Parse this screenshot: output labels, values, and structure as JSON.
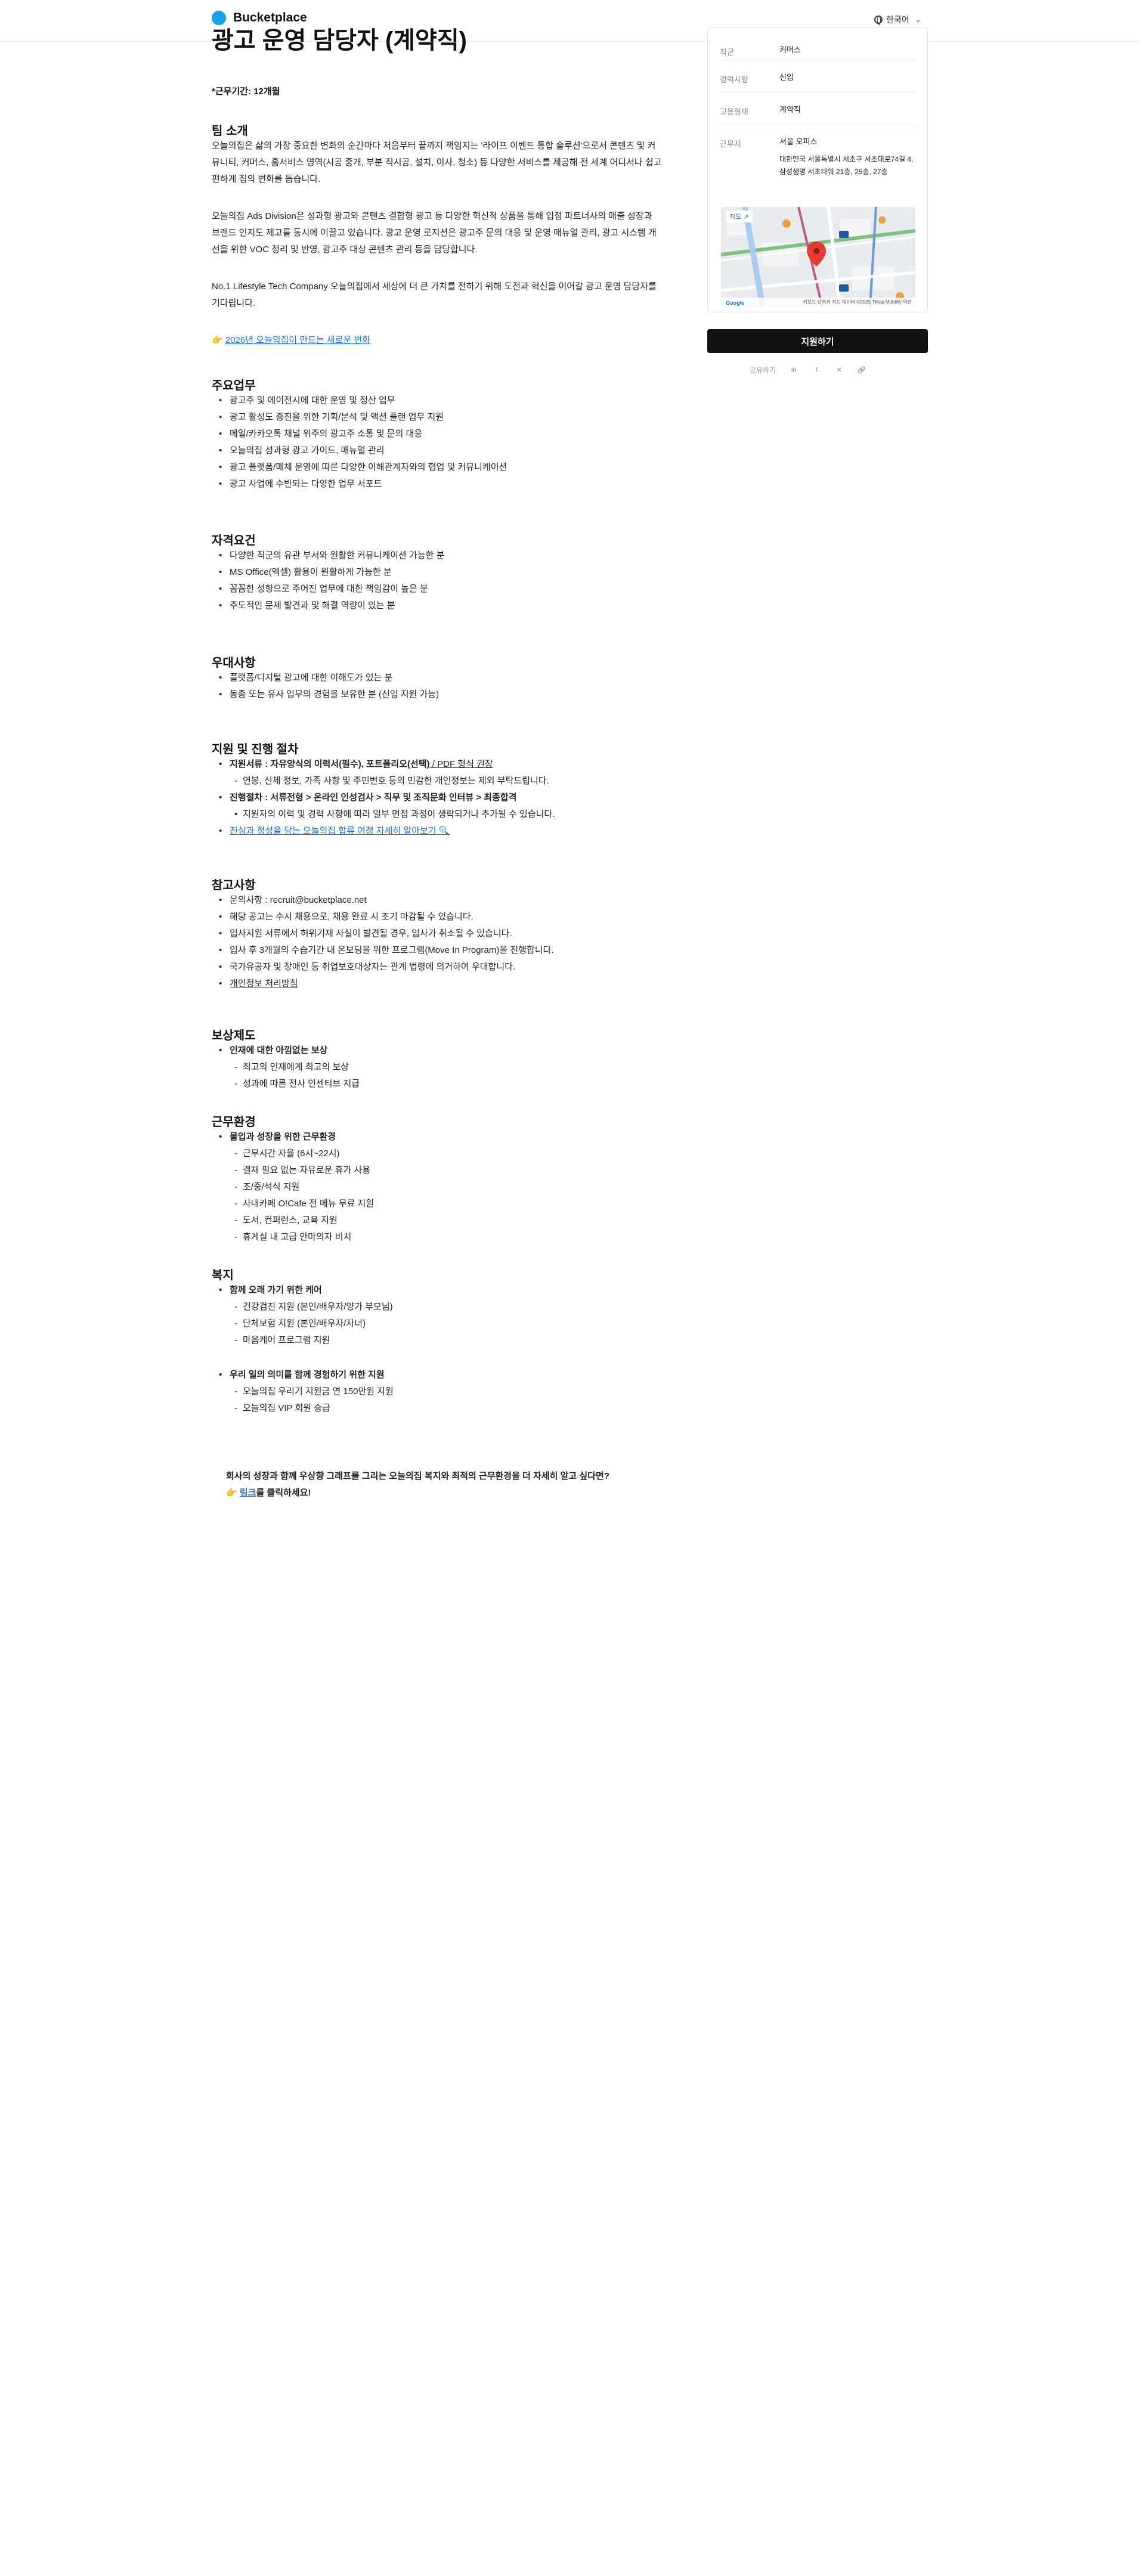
{
  "header": {
    "brand": "Bucketplace",
    "language": "한국어"
  },
  "job": {
    "title": "광고 운영 담당자 (계약직)",
    "duration": "*근무기간: 12개월"
  },
  "team": {
    "heading": "팀 소개",
    "p1": "오늘의집은 삶의 가장 중요한 변화의 순간마다 처음부터 끝까지 책임지는 '라이프 이벤트 통합 솔루션'으로서 콘텐츠 및 커뮤니티, 커머스, 홈서비스 영역(시공 중개, 부분 직시공, 설치, 이사, 청소) 등 다양한 서비스를 제공해 전 세계 어디서나 쉽고 편하게 집의 변화를 돕습니다.",
    "p2": "오늘의집 Ads Division은 성과형 광고와 콘텐츠 결합형 광고 등 다양한 혁신적 상품을 통해 입점 파트너사의 매출 성장과 브랜드 인지도 제고를 동시에 이끌고 있습니다. 광고 운영 로지션은 광고주 문의 대응 및 운영 매뉴얼 관리, 광고 시스템 개선을 위한 VOC 정리 및 반영, 광고주 대상 콘텐츠 관리 등을 담당합니다.",
    "p3": "No.1 Lifestyle Tech Company 오늘의집에서 세상에 더 큰 가치를 전하기 위해 도전과 혁신을 이어갈 광고 운영 담당자를 기다립니다.",
    "link_prefix": "👉",
    "link_text": "2026년 오늘의집이 만드는 새로운 변화"
  },
  "duties": {
    "heading": "주요업무",
    "items": [
      "광고주 및 에이전시에 대한 운영 및 정산 업무",
      "광고 활성도 증진을 위한 기획/분석 및 액션 플랜 업무 지원",
      "메일/카카오톡 채널 위주의 광고주 소통 및 문의 대응",
      "오늘의집 성과형 광고 가이드, 매뉴얼 관리",
      "광고 플랫폼/매체 운영에 따른 다양한 이해관계자와의 협업 및 커뮤니케이션",
      "광고 사업에 수반되는 다양한 업무 서포트"
    ]
  },
  "requirements": {
    "heading": "자격요건",
    "items": [
      "다양한 직군의 유관 부서와 원활한 커뮤니케이션 가능한 분",
      "MS Office(엑셀) 활용이 원활하게 가능한 분",
      "꼼꼼한 성향으로 주어진 업무에 대한 책임감이 높은 분",
      "주도적인 문제 발견과 및 해결 역량이 있는 분"
    ]
  },
  "preferred": {
    "heading": "우대사항",
    "items": [
      "플랫폼/디지털 광고에 대한 이해도가 있는 분",
      "동종 또는 유사 업무의 경험을 보유한 분 (신입 지원 가능)"
    ]
  },
  "process": {
    "heading": "지원 및 진행 절차",
    "doc_label": "지원서류 : 자유양식의 이력서(필수), 포트폴리오(선택)",
    "doc_suffix": " / PDF 형식 권장",
    "doc_note": "연봉, 신체 정보, 가족 사항 및 주민번호 등의 민감한 개인정보는 제외 부탁드립니다.",
    "steps_label": "진행절차 : 서류전형 > 온라인 인성검사 > 직무 및 조직문화 인터뷰 > 최종합격",
    "steps_note": "지원자의 이력 및 경력 사항에 따라 일부 면접 과정이 생략되거나 추가될 수 있습니다.",
    "faq_link": "진심과 정성을 담는 오늘의집 합류 여정 자세히 알아보기 🔍"
  },
  "notes": {
    "heading": "참고사항",
    "items": [
      "문의사항 : recruit@bucketplace.net",
      "해당 공고는 수시 채용으로, 채용 완료 시 조기 마감될 수 있습니다.",
      "입사지원 서류에서 허위기재 사실이 발견될 경우, 입사가 취소될 수 있습니다.",
      "입사 후 3개월의 수습기간 내 온보딩을 위한 프로그램(Move In Program)을 진행합니다.",
      "국가유공자 및 장애인 등 취업보호대상자는 관계 법령에 의거하여 우대합니다."
    ],
    "privacy": "개인정보 처리방침"
  },
  "compensation": {
    "heading": "보상제도",
    "title": "인재에 대한 아낌없는 보상",
    "items": [
      "최고의 인재에게 최고의 보상",
      "성과에 따른 전사 인센티브 지급"
    ]
  },
  "environment": {
    "heading": "근무환경",
    "title": "몰입과 성장을 위한 근무환경",
    "items": [
      "근무시간 자율 (6시~22시)",
      "결재 필요 없는 자유로운 휴가 사용",
      "조/중/석식 지원",
      "사내카페 O!Cafe 전 메뉴 무료 지원",
      "도서, 컨퍼런스, 교육 지원",
      "휴게실 내 고급 안마의자 비치"
    ]
  },
  "welfare": {
    "heading": "복지",
    "title1": "함께 오래 가기 위한 케어",
    "items1": [
      "건강검진 지원 (본인/배우자/양가 부모님)",
      "단체보험 지원 (본인/배우자/자녀)",
      "마음케어 프로그램 지원"
    ],
    "title2": "우리 일의 의미를 함께 경험하기 위한 지원",
    "items2": [
      "오늘의집 우리기 지원금 연 150만원 지원",
      "오늘의집 VIP 회원 승급"
    ]
  },
  "closing": {
    "line1": "회사의 성장과 함께 우상향 그래프를 그리는 오늘의집 복지와 최적의 근무환경을 더 자세히 알고 싶다면?",
    "prefix": "👉 ",
    "link": "링크",
    "suffix": "를 클릭하세요!"
  },
  "panel": {
    "rows": [
      {
        "label": "직군",
        "value": "커머스"
      },
      {
        "label": "경력사항",
        "value": "신입"
      },
      {
        "label": "고용형태",
        "value": "계약직"
      }
    ],
    "location_label": "근무지",
    "location_name": "서울 오피스",
    "location_address": "대한민국 서울특별시 서초구 서초대로74길 4, 삼성생명 서초타워 21층, 25층, 27층",
    "map_badge": "지도",
    "map_footer": "키보드 단축키   지도 데이터 ©2025 TMap Mobility   약관"
  },
  "apply_label": "지원하기",
  "share_label": "공유하기"
}
